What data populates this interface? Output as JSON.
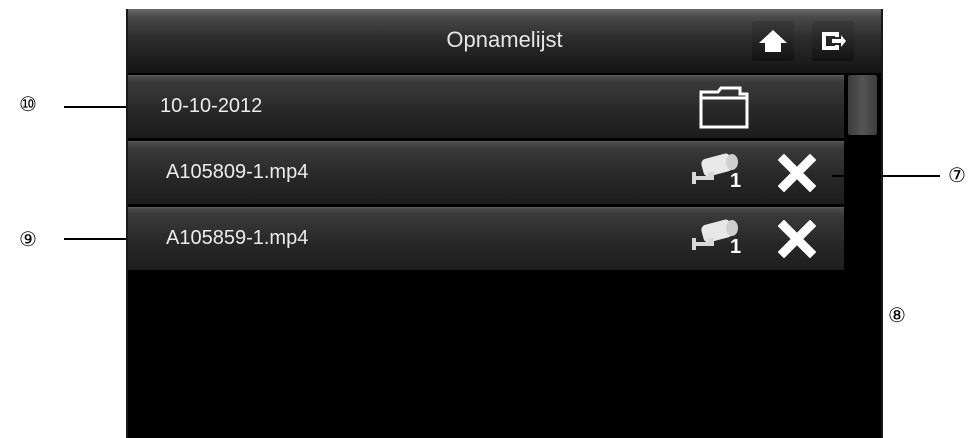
{
  "screen": {
    "title": "Opnamelijst",
    "home_icon": "home-icon",
    "exit_icon": "exit-icon"
  },
  "list": {
    "folder": {
      "label": "10-10-2012",
      "icon": "folder-icon"
    },
    "files": [
      {
        "label": "A105809-1.mp4",
        "camera_number": "1",
        "camera_icon": "camera-icon",
        "delete_icon": "delete-icon"
      },
      {
        "label": "A105859-1.mp4",
        "camera_number": "1",
        "camera_icon": "camera-icon",
        "delete_icon": "delete-icon"
      }
    ]
  },
  "callouts": {
    "c7": "⑦",
    "c8": "⑧",
    "c9": "⑨",
    "c10": "⑩"
  },
  "colors": {
    "screen_background": "#000000",
    "row_background": "#2c2c2c",
    "text": "#ececec",
    "icon": "#ffffff"
  }
}
